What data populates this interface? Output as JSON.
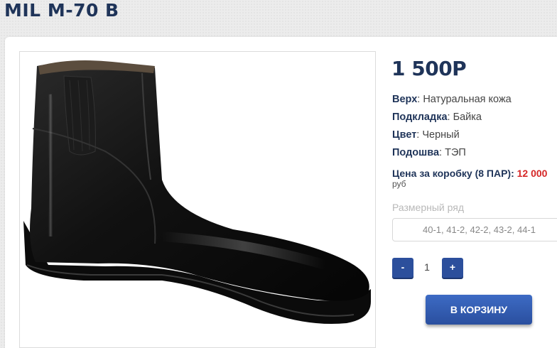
{
  "product": {
    "title": "MIL M-70 B",
    "price": "1 500Р",
    "specs": [
      {
        "label": "Верх",
        "value": ": Натуральная кожа"
      },
      {
        "label": "Подкладка",
        "value": ": Байка"
      },
      {
        "label": "Цвет",
        "value": ": Черный"
      },
      {
        "label": "Подошва",
        "value": ": ТЭП"
      }
    ],
    "box_price_label": "Цена за коробку (8 ПАР): ",
    "box_price_value": "12 000",
    "box_price_unit": "руб",
    "size_label": "Размерный ряд",
    "size_value": "40-1, 41-2, 42-2, 43-2, 44-1",
    "image_alt": "black leather boot"
  },
  "quantity": {
    "minus_label": "-",
    "value": "1",
    "plus_label": "+"
  },
  "cart_button_label": "В КОРЗИНУ",
  "colors": {
    "brand_navy": "#1f3459",
    "button_blue": "#2c4f9c",
    "price_red": "#d52626"
  }
}
